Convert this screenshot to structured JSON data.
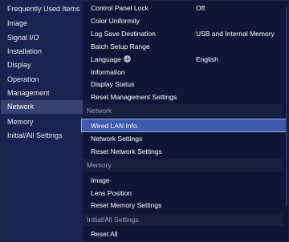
{
  "sidebar": {
    "items": [
      {
        "label": "Frequently Used Items"
      },
      {
        "label": "Image"
      },
      {
        "label": "Signal I/O"
      },
      {
        "label": "Installation"
      },
      {
        "label": "Display"
      },
      {
        "label": "Operation"
      },
      {
        "label": "Management"
      },
      {
        "label": "Network",
        "selected": true
      },
      {
        "label": "Memory"
      },
      {
        "label": "Initial/All Settings"
      }
    ]
  },
  "main": {
    "rows": [
      {
        "label": "Control Panel Lock",
        "value": "Off"
      },
      {
        "label": "Color Uniformity"
      },
      {
        "label": "Log Save Destination",
        "value": "USB and Internal Memory"
      },
      {
        "label": "Batch Setup Range"
      },
      {
        "label": "Language",
        "value": "English",
        "icon": "globe-icon"
      },
      {
        "label": "Information"
      },
      {
        "label": "Display Status"
      },
      {
        "label": "Reset Management Settings"
      },
      {
        "label": "Network",
        "section": true
      },
      {
        "label": "Wired LAN Info.",
        "selected": true
      },
      {
        "label": "Network Settings"
      },
      {
        "label": "Reset Network Settings"
      },
      {
        "label": "Memory",
        "section": true
      },
      {
        "label": "Image"
      },
      {
        "label": "Lens Position"
      },
      {
        "label": "Reset Memory Settings"
      },
      {
        "label": "Initial/All Settings",
        "section": true
      },
      {
        "label": "Reset All"
      }
    ]
  },
  "colors": {
    "background": "#101638",
    "sidebar": "#1a2250",
    "sidebar_selected": "#3a4272",
    "row_selected": "#3e59ad",
    "section_header_text": "#9aa0b8"
  }
}
